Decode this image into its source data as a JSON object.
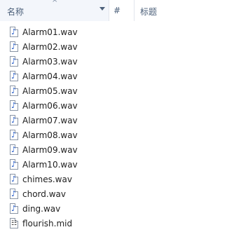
{
  "header": {
    "name_label": "名称",
    "number_label": "#",
    "title_label": "标题",
    "sort_glyph": "^"
  },
  "files": [
    {
      "name": "Alarm01.wav",
      "icon": "audio-file-icon"
    },
    {
      "name": "Alarm02.wav",
      "icon": "audio-file-icon"
    },
    {
      "name": "Alarm03.wav",
      "icon": "audio-file-icon"
    },
    {
      "name": "Alarm04.wav",
      "icon": "audio-file-icon"
    },
    {
      "name": "Alarm05.wav",
      "icon": "audio-file-icon"
    },
    {
      "name": "Alarm06.wav",
      "icon": "audio-file-icon"
    },
    {
      "name": "Alarm07.wav",
      "icon": "audio-file-icon"
    },
    {
      "name": "Alarm08.wav",
      "icon": "audio-file-icon"
    },
    {
      "name": "Alarm09.wav",
      "icon": "audio-file-icon"
    },
    {
      "name": "Alarm10.wav",
      "icon": "audio-file-icon"
    },
    {
      "name": "chimes.wav",
      "icon": "audio-file-icon"
    },
    {
      "name": "chord.wav",
      "icon": "audio-file-icon"
    },
    {
      "name": "ding.wav",
      "icon": "audio-file-icon"
    },
    {
      "name": "flourish.mid",
      "icon": "midi-file-icon"
    }
  ]
}
